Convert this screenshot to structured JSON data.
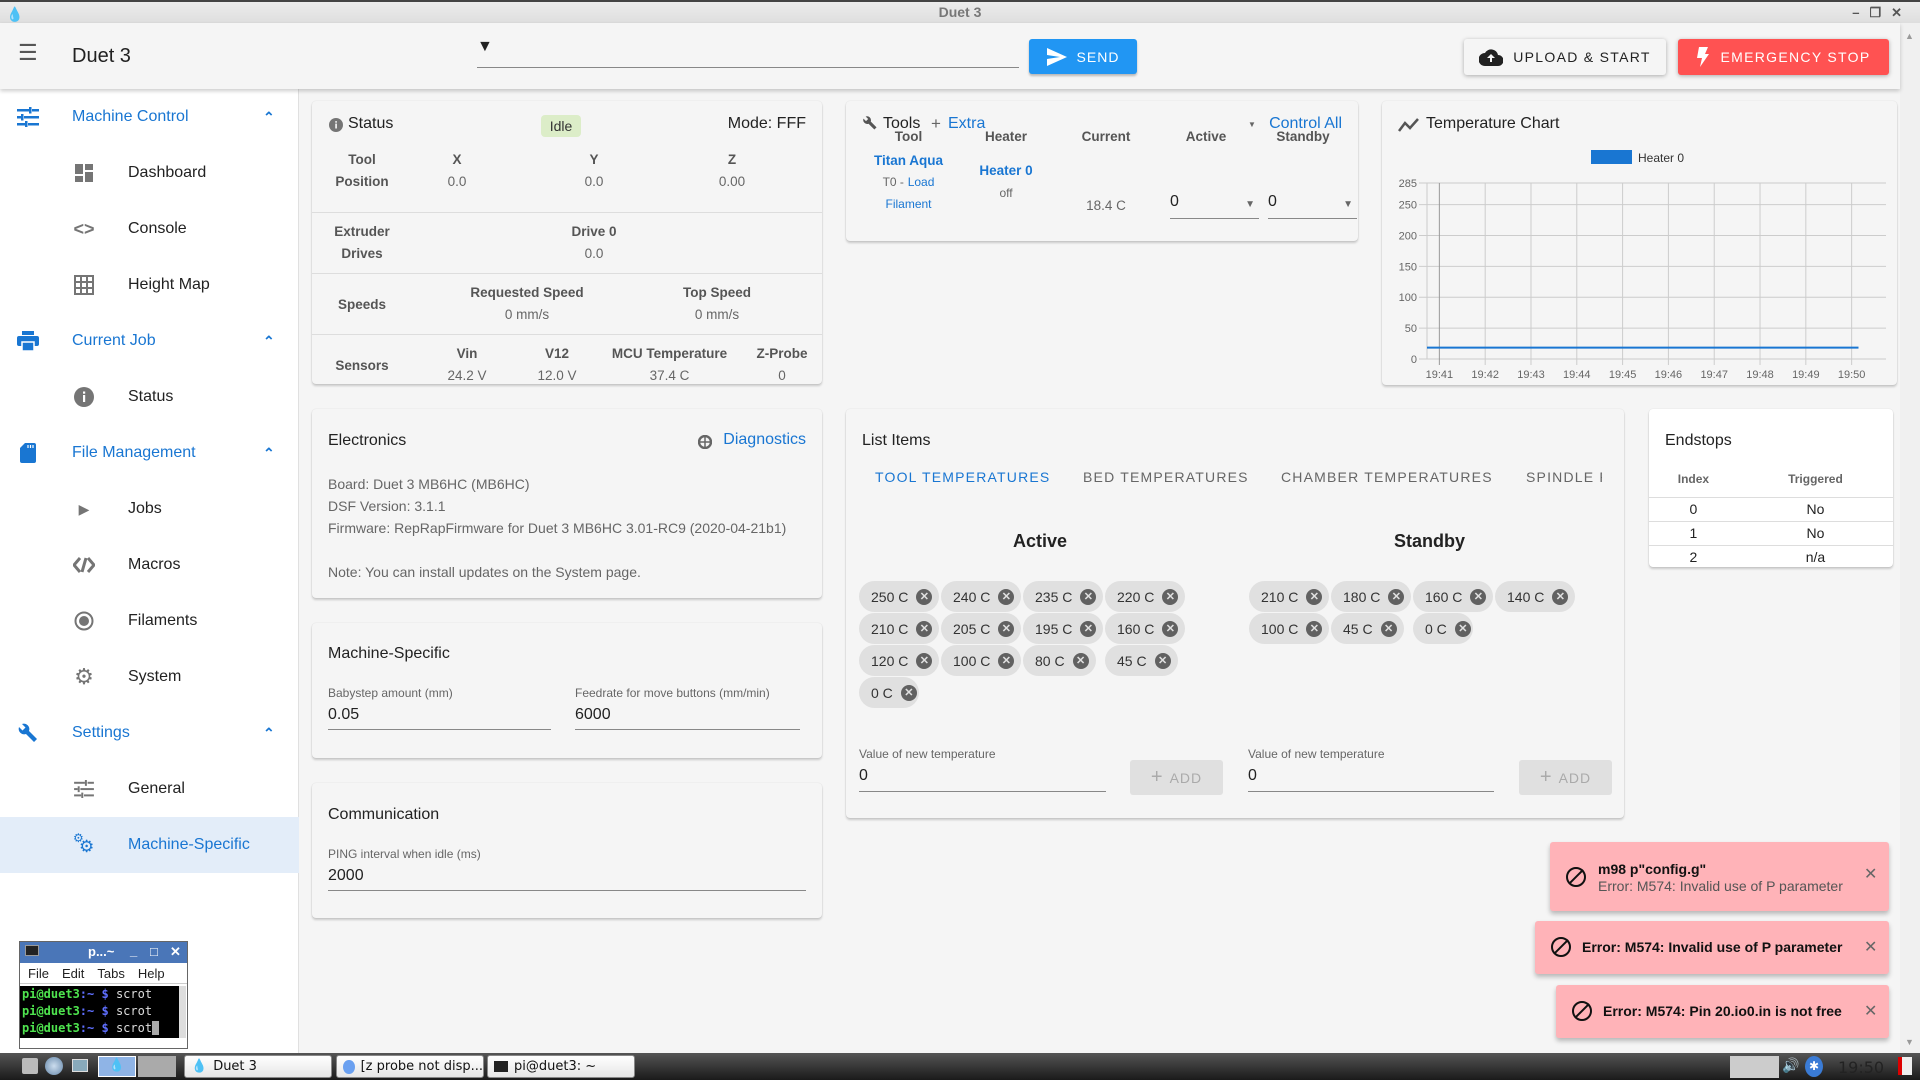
{
  "window": {
    "title": "Duet 3",
    "controls": [
      "minimize",
      "restore",
      "close"
    ]
  },
  "appbar": {
    "title": "Duet 3",
    "command_input": {
      "value": "",
      "placeholder": ""
    },
    "send_label": "SEND",
    "upload_label": "UPLOAD & START",
    "estop_label": "EMERGENCY STOP",
    "colors": {
      "primary": "#1976d2",
      "send": "#2196f3",
      "estop": "#ff5252"
    }
  },
  "sidebar": {
    "groups": [
      {
        "label": "Machine Control",
        "icon": "tune-icon",
        "items": [
          {
            "label": "Dashboard",
            "icon": "dashboard-icon"
          },
          {
            "label": "Console",
            "icon": "code-icon"
          },
          {
            "label": "Height Map",
            "icon": "grid-icon"
          }
        ]
      },
      {
        "label": "Current Job",
        "icon": "printer-icon",
        "items": [
          {
            "label": "Status",
            "icon": "info-icon"
          }
        ]
      },
      {
        "label": "File Management",
        "icon": "sd-card-icon",
        "items": [
          {
            "label": "Jobs",
            "icon": "play-icon"
          },
          {
            "label": "Macros",
            "icon": "macro-icon"
          },
          {
            "label": "Filaments",
            "icon": "radio-icon"
          },
          {
            "label": "System",
            "icon": "gear-icon"
          }
        ]
      },
      {
        "label": "Settings",
        "icon": "wrench-icon",
        "items": [
          {
            "label": "General",
            "icon": "tune-icon"
          },
          {
            "label": "Machine-Specific",
            "icon": "gears-icon",
            "active": true
          }
        ]
      }
    ]
  },
  "status": {
    "title": "Status",
    "state": "Idle",
    "mode": "Mode: FFF",
    "tool_position": {
      "label_1": "Tool",
      "label_2": "Position",
      "axes": [
        {
          "name": "X",
          "value": "0.0"
        },
        {
          "name": "Y",
          "value": "0.0"
        },
        {
          "name": "Z",
          "value": "0.00"
        }
      ]
    },
    "extruder": {
      "label_1": "Extruder",
      "label_2": "Drives",
      "drives": [
        {
          "name": "Drive 0",
          "value": "0.0"
        }
      ]
    },
    "speeds": {
      "label": "Speeds",
      "items": [
        {
          "name": "Requested Speed",
          "value": "0 mm/s"
        },
        {
          "name": "Top Speed",
          "value": "0 mm/s"
        }
      ]
    },
    "sensors": {
      "label": "Sensors",
      "items": [
        {
          "name": "Vin",
          "value": "24.2 V"
        },
        {
          "name": "V12",
          "value": "12.0 V"
        },
        {
          "name": "MCU Temperature",
          "value": "37.4 C"
        },
        {
          "name": "Z-Probe",
          "value": "0"
        }
      ]
    }
  },
  "tools": {
    "title": "Tools",
    "extra_label": "Extra",
    "control_all_label": "Control All",
    "headers": [
      "Tool",
      "Heater",
      "Current",
      "Active",
      "Standby"
    ],
    "rows": [
      {
        "tool": "Titan Aqua",
        "tool_sub": "T0 -",
        "load_link": "Load",
        "load_link_2": "Filament",
        "heater": "Heater 0",
        "heater_state": "off",
        "current": "18.4 C",
        "active": "0",
        "standby": "0"
      }
    ]
  },
  "chart": {
    "title": "Temperature Chart"
  },
  "chart_data": {
    "type": "line",
    "title": "Temperature Chart",
    "legend": [
      "Heater 0"
    ],
    "legend_position": "top",
    "x": [
      "19:41",
      "19:42",
      "19:43",
      "19:44",
      "19:45",
      "19:46",
      "19:47",
      "19:48",
      "19:49",
      "19:50"
    ],
    "yticks": [
      0,
      50,
      100,
      150,
      200,
      250,
      285
    ],
    "ylim": [
      0,
      285
    ],
    "xlim_minutes": [
      -0.27,
      9.75
    ],
    "grid": true,
    "series": [
      {
        "name": "Heater 0",
        "color": "#1976d2",
        "x_start": -0.27,
        "x_end": 9.15,
        "values": [
          18.4,
          18.4,
          18.4,
          18.4,
          18.4,
          18.4,
          18.4,
          18.4,
          18.4,
          18.4,
          18.4
        ]
      }
    ],
    "xlabel": "",
    "ylabel": ""
  },
  "electronics": {
    "title": "Electronics",
    "diagnostics_label": "Diagnostics",
    "lines": [
      "Board: Duet 3 MB6HC (MB6HC)",
      "DSF Version: 3.1.1",
      "Firmware: RepRapFirmware for Duet 3 MB6HC 3.01-RC9 (2020-04-21b1)"
    ],
    "note": "Note: You can install updates on the System page."
  },
  "machine_specific": {
    "title": "Machine-Specific",
    "babystep": {
      "label": "Babystep amount (mm)",
      "value": "0.05"
    },
    "feedrate": {
      "label": "Feedrate for move buttons (mm/min)",
      "value": "6000"
    }
  },
  "communication": {
    "title": "Communication",
    "ping": {
      "label": "PING interval when idle (ms)",
      "value": "2000"
    }
  },
  "list_items": {
    "title": "List Items",
    "tabs": [
      "TOOL TEMPERATURES",
      "BED TEMPERATURES",
      "CHAMBER TEMPERATURES",
      "SPINDLE R"
    ],
    "active_title": "Active",
    "standby_title": "Standby",
    "active": [
      "250 C",
      "240 C",
      "235 C",
      "220 C",
      "210 C",
      "205 C",
      "195 C",
      "160 C",
      "120 C",
      "100 C",
      "80 C",
      "45 C",
      "0 C"
    ],
    "standby": [
      "210 C",
      "180 C",
      "160 C",
      "140 C",
      "100 C",
      "45 C",
      "0 C"
    ],
    "new_label": "Value of new temperature",
    "new_active_value": "0",
    "new_standby_value": "0",
    "add_label": "ADD"
  },
  "endstops": {
    "title": "Endstops",
    "headers": [
      "Index",
      "Triggered"
    ],
    "rows": [
      {
        "index": "0",
        "triggered": "No"
      },
      {
        "index": "1",
        "triggered": "No"
      },
      {
        "index": "2",
        "triggered": "n/a"
      }
    ]
  },
  "toasts": [
    {
      "title": "m98 p\"config.g\"",
      "message": "Error: M574: Invalid use of P parameter"
    },
    {
      "title": "Error: M574: Invalid use of P parameter",
      "message": ""
    },
    {
      "title": "Error: M574: Pin 20.io0.in is not free",
      "message": ""
    }
  ],
  "terminal": {
    "title": "p...~",
    "menu": [
      "File",
      "Edit",
      "Tabs",
      "Help"
    ],
    "lines": [
      {
        "user": "pi@duet3",
        "path": ":~",
        "prompt": "$",
        "cmd": "scrot"
      },
      {
        "user": "pi@duet3",
        "path": ":~",
        "prompt": "$",
        "cmd": "scrot"
      },
      {
        "user": "pi@duet3",
        "path": ":~",
        "prompt": "$",
        "cmd": "scrot"
      }
    ]
  },
  "taskbar": {
    "tasks": [
      "Duet 3",
      "[z probe not disp...",
      "pi@duet3: ~"
    ],
    "clock": "19:50"
  }
}
